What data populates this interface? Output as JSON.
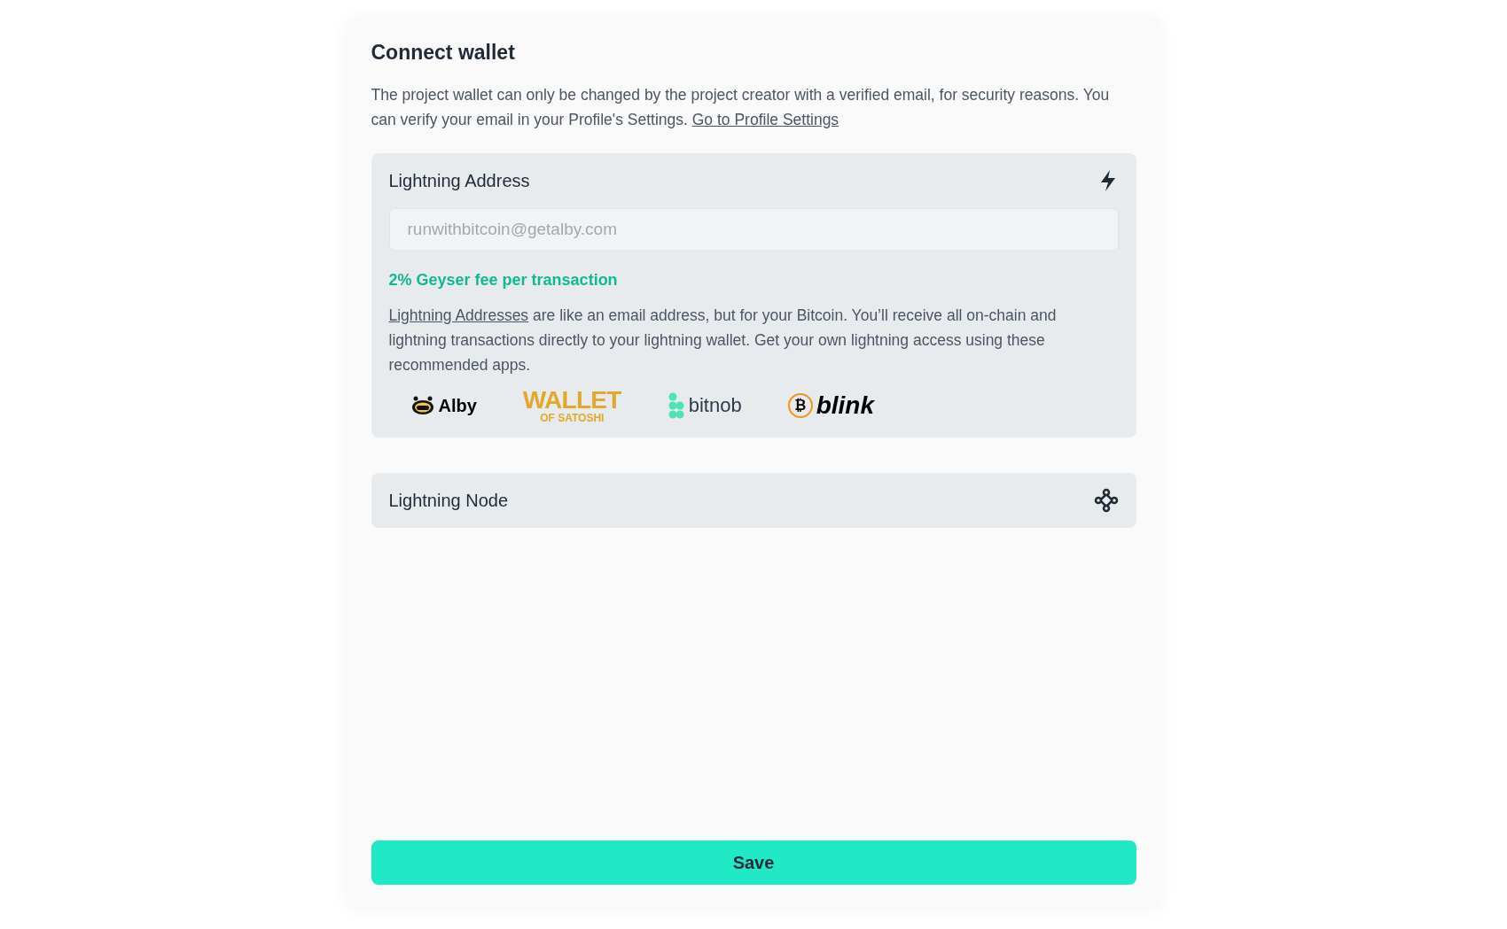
{
  "title": "Connect wallet",
  "description": {
    "text": "The project wallet can only be changed by the project creator with a verified email, for security reasons. You can verify your email in your Profile's Settings.",
    "link": "Go to Profile Settings"
  },
  "sections": [
    {
      "kind": "address",
      "title": "Lightning Address",
      "input": {
        "placeholder": "runwithbitcoin@getalby.com"
      },
      "fee": "2% Geyser fee per transaction",
      "info": {
        "link": "Lightning Addresses",
        "text": "are like an email address, but for your Bitcoin. You’ll receive all on-chain and lightning transactions directly to your lightning wallet. Get your own lightning access using these recommended apps."
      },
      "apps": [
        {
          "kind": "alby",
          "name": "Alby"
        },
        {
          "kind": "wos",
          "name": "WALLET",
          "sub": "OF SATOSHI"
        },
        {
          "kind": "bitnob",
          "name": "bitnob"
        },
        {
          "kind": "blink",
          "symbol": "₿",
          "name": "blink"
        }
      ]
    },
    {
      "kind": "node",
      "title": "Lightning Node"
    }
  ],
  "save_button": "Save"
}
